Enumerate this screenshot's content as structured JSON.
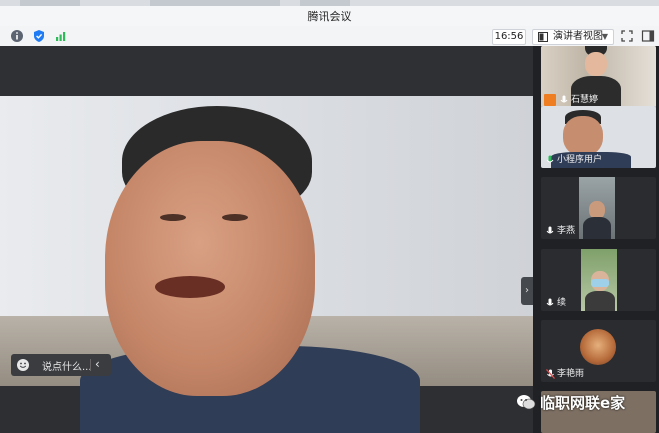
{
  "window": {
    "title": "腾讯会议"
  },
  "toolbar": {
    "info_icon": "info-icon",
    "security_icon": "shield-icon",
    "signal_icon": "signal-icon",
    "clock": "16:56",
    "view_mode_label": "演讲者视图",
    "fullscreen_icon": "fullscreen-icon",
    "sidebar_icon": "panel-icon"
  },
  "chat": {
    "placeholder": "说点什么..."
  },
  "participants": [
    {
      "name": "石慧婷",
      "mic": "mic-icon",
      "host_badge": true
    },
    {
      "name": "小程序用户",
      "mic": "mic-icon",
      "host_badge": false
    },
    {
      "name": "李燕",
      "mic": "mic-icon",
      "host_badge": false
    },
    {
      "name": "续",
      "mic": "mic-icon",
      "host_badge": false
    },
    {
      "name": "李艳雨",
      "mic": "mic-off-icon",
      "host_badge": false
    }
  ],
  "watermark": {
    "text": "临职网联e家"
  },
  "colors": {
    "accent": "#1f7cf5",
    "signal": "#2dbb5a",
    "badge": "#ef7d22"
  }
}
